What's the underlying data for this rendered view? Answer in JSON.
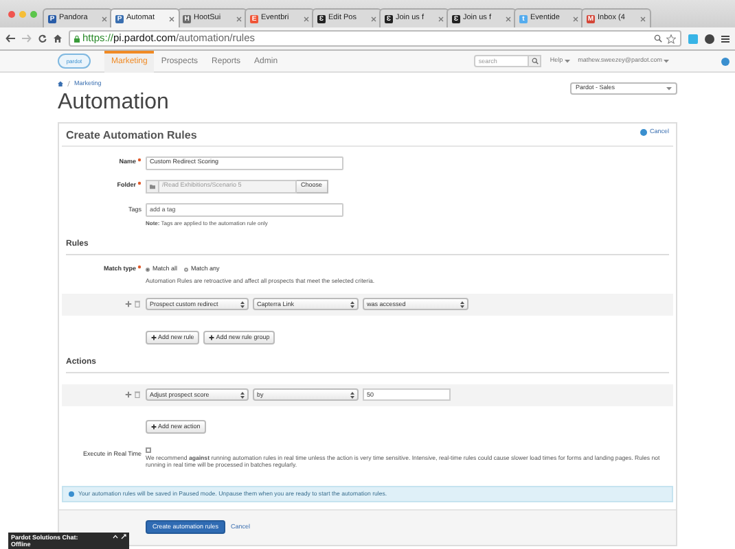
{
  "browser": {
    "tabs": [
      {
        "label": "Pandora",
        "selected": false,
        "icon": "P",
        "color": "#2a5da8"
      },
      {
        "label": "Automat",
        "selected": true,
        "icon": "P",
        "color": "#3a6fb0"
      },
      {
        "label": "HootSui",
        "selected": false,
        "icon": "H",
        "color": "#6b6b6b"
      },
      {
        "label": "Eventbri",
        "selected": false,
        "icon": "E",
        "color": "#f05537"
      },
      {
        "label": "Edit Pos",
        "selected": false,
        "icon": "Ɛ",
        "color": "#222222"
      },
      {
        "label": "Join us f",
        "selected": false,
        "icon": "Ɛ",
        "color": "#222222"
      },
      {
        "label": "Join us f",
        "selected": false,
        "icon": "Ɛ",
        "color": "#222222"
      },
      {
        "label": "Eventide",
        "selected": false,
        "icon": "t",
        "color": "#55acee"
      },
      {
        "label": "Inbox (4",
        "selected": false,
        "icon": "M",
        "color": "#d44638"
      }
    ],
    "url": {
      "scheme": "https://",
      "host": "pi.pardot.com",
      "path": "/automation/rules"
    }
  },
  "nav": {
    "logo": "pardot",
    "items": [
      {
        "label": "Marketing",
        "selected": true
      },
      {
        "label": "Prospects",
        "selected": false
      },
      {
        "label": "Reports",
        "selected": false
      },
      {
        "label": "Admin",
        "selected": false
      }
    ],
    "search_placeholder": "search",
    "help": "Help",
    "user": "mathew.sweezey@pardot.com"
  },
  "breadcrumb": "Marketing",
  "title": "Automation",
  "account_select": "Pardot - Sales",
  "panel": {
    "title": "Create Automation Rules",
    "cancel": "Cancel",
    "name_label": "Name",
    "name_value": "Custom Redirect Scoring",
    "folder_label": "Folder",
    "folder_value": "/Read Exhibitions/Scenario 5",
    "choose": "Choose",
    "tags_label": "Tags",
    "tags_placeholder": "add a tag",
    "tags_note": "**Note:** Tags are applied to the automation rule only",
    "rules_heading": "Rules",
    "match_label": "Match type",
    "match_options": [
      {
        "label": "Match all",
        "selected": true
      },
      {
        "label": "Match any",
        "selected": false
      }
    ],
    "match_note": "Automation Rules are retroactive and affect all prospects that meet the selected criteria.",
    "rule": [
      "Prospect custom redirect",
      "Capterra Link",
      "was accessed"
    ],
    "rule_buttons": [
      "Add new rule",
      "Add new rule group"
    ],
    "actions_heading": "Actions",
    "action": [
      "Adjust prospect score",
      "by"
    ],
    "action_value": "50",
    "add_action": "Add new action",
    "realtime_label": "Execute in Real Time",
    "realtime_checked": false,
    "realtime_note": "We recommend **against** running automation rules in real time unless the action is very time sensitive. Intensive, real-time rules could cause slower load times for forms and landing pages. Rules not running in real time will be processed in batches regularly.",
    "alert": "Your automation rules will be saved in Paused mode. Unpause them when you are ready to start the automation rules.",
    "submit": "Create automation rules",
    "footer_cancel": "Cancel"
  },
  "chat": "Pardot Solutions Chat: Offline"
}
